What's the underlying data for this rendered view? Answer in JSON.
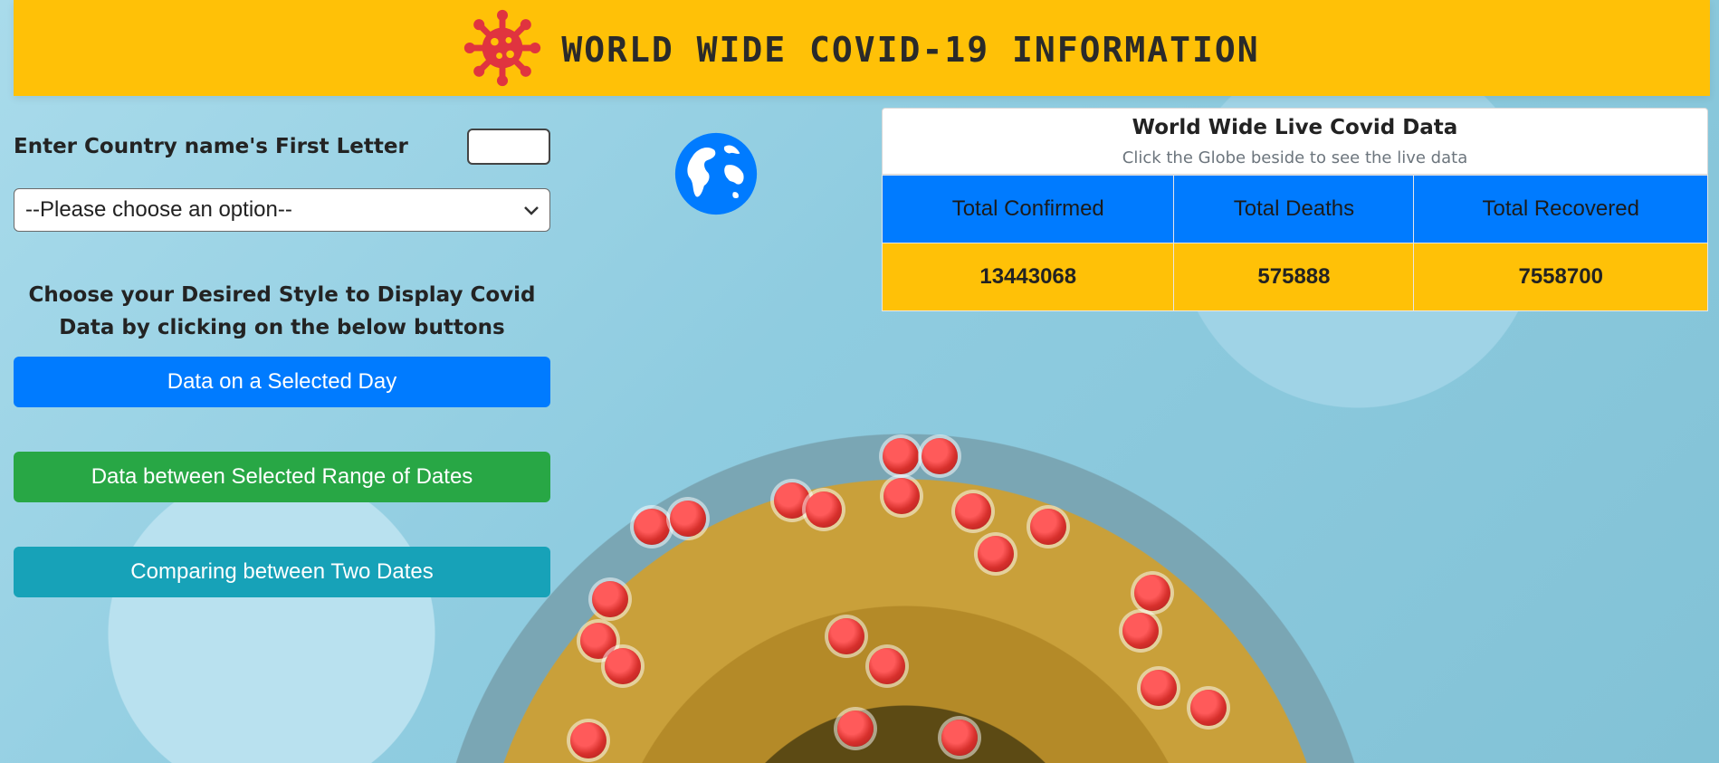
{
  "header": {
    "title": "WORLD WIDE COVID-19 INFORMATION",
    "icon": "virus-icon"
  },
  "left_panel": {
    "country_label": "Enter Country name's First Letter",
    "country_input_value": "",
    "select_value": "--Please choose an option--",
    "choose_text": "Choose your Desired Style to Display Covid Data by clicking on the below buttons",
    "buttons": {
      "selected_day": "Data on a Selected Day",
      "range_dates": "Data between Selected Range of Dates",
      "two_dates": "Comparing between Two Dates"
    },
    "colors": {
      "selected_day": "#007bff",
      "range_dates": "#28a745",
      "two_dates": "#17a2b8"
    }
  },
  "globe": {
    "icon": "globe-icon",
    "color": "#007bff"
  },
  "live_data": {
    "title": "World Wide Live Covid Data",
    "subtitle": "Click the Globe beside to see the live data",
    "headers": [
      "Total Confirmed",
      "Total Deaths",
      "Total Recovered"
    ],
    "values": [
      "13443068",
      "575888",
      "7558700"
    ]
  }
}
